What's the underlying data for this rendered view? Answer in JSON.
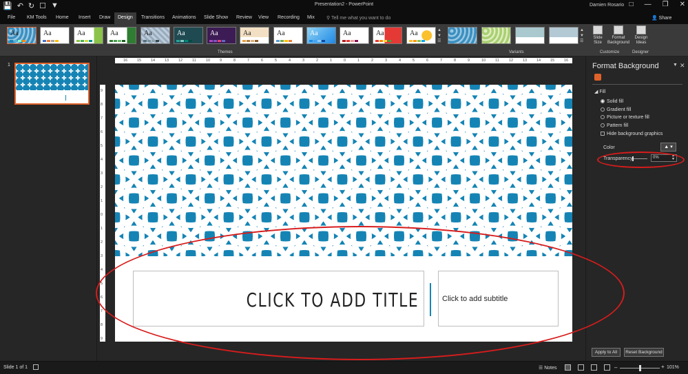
{
  "window": {
    "title": "Presentation2 - PowerPoint",
    "user": "Damien Rosario",
    "share_label": "Share",
    "tell_me": "Tell me what you want to do"
  },
  "tabs": [
    "File",
    "KM Tools",
    "Home",
    "Insert",
    "Draw",
    "Design",
    "Transitions",
    "Animations",
    "Slide Show",
    "Review",
    "View",
    "Recording",
    "Mix"
  ],
  "active_tab": "Design",
  "ribbon": {
    "themes_label": "Themes",
    "theme_preview_text": "Aa",
    "variants_label": "Variants",
    "customize_label": "Customize",
    "designer_label": "Designer",
    "slide_size_label": "Slide Size",
    "format_background_label": "Format Background",
    "design_ideas_label": "Design Ideas"
  },
  "ruler": {
    "top_ticks": [
      "16",
      "15",
      "14",
      "13",
      "12",
      "11",
      "10",
      "9",
      "8",
      "7",
      "6",
      "5",
      "4",
      "3",
      "2",
      "1",
      "0",
      "1",
      "2",
      "3",
      "4",
      "5",
      "6",
      "7",
      "8",
      "9",
      "10",
      "11",
      "12",
      "13",
      "14",
      "15",
      "16"
    ],
    "left_ticks": [
      "9",
      "8",
      "7",
      "6",
      "5",
      "4",
      "3",
      "2",
      "1",
      "0",
      "1",
      "2",
      "3",
      "4",
      "5",
      "6",
      "7",
      "8",
      "9"
    ]
  },
  "thumbnails": {
    "slide_number": "1"
  },
  "slide": {
    "title_placeholder": "CLICK TO ADD TITLE",
    "subtitle_placeholder": "Click to add subtitle"
  },
  "format_pane": {
    "title": "Format Background",
    "fill_header": "Fill",
    "options": [
      "Solid fill",
      "Gradient fill",
      "Picture or texture fill",
      "Pattern fill"
    ],
    "selected_option": "Solid fill",
    "hide_graphics": "Hide background graphics",
    "color_label": "Color",
    "transparency_label": "Transparency",
    "transparency_value": "0%",
    "apply_all": "Apply to All",
    "reset": "Reset Background"
  },
  "status": {
    "slide_of": "Slide 1 of 1",
    "notes": "Notes",
    "zoom": "101%"
  },
  "colors": {
    "accent_blue": "#1584b4",
    "annotation_red": "#d81c1c",
    "selection_orange": "#e0622a"
  }
}
